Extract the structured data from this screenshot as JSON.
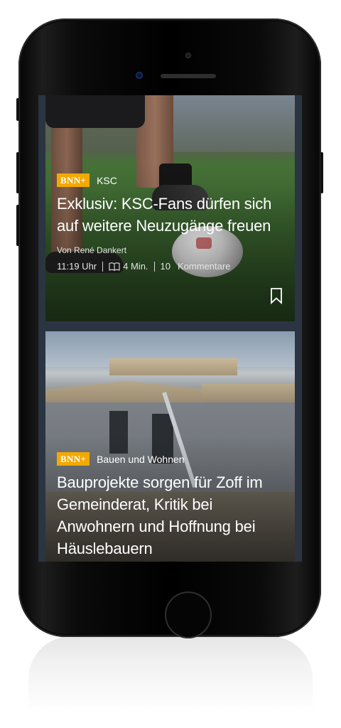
{
  "articles": [
    {
      "badge": "BNN+",
      "category": "KSC",
      "headline": "Exklusiv: KSC-Fans dürfen sich auf weitere Neuzugänge freuen",
      "author": "Von René Dankert",
      "time": "11:19 Uhr",
      "read_time": "4 Min.",
      "comments_count": "10",
      "comments_label": "Kommentare",
      "bookmark_icon": "bookmark-icon",
      "book_icon": "book-icon"
    },
    {
      "badge": "BNN+",
      "category": "Bauen und Wohnen",
      "headline": "Bauprojekte sorgen für Zoff im Gemeinderat, Kritik bei Anwohnern und Hoffnung bei Häuslebauern"
    }
  ],
  "colors": {
    "badge": "#f2a900",
    "screen_background": "#2b3441",
    "text": "#ffffff"
  }
}
